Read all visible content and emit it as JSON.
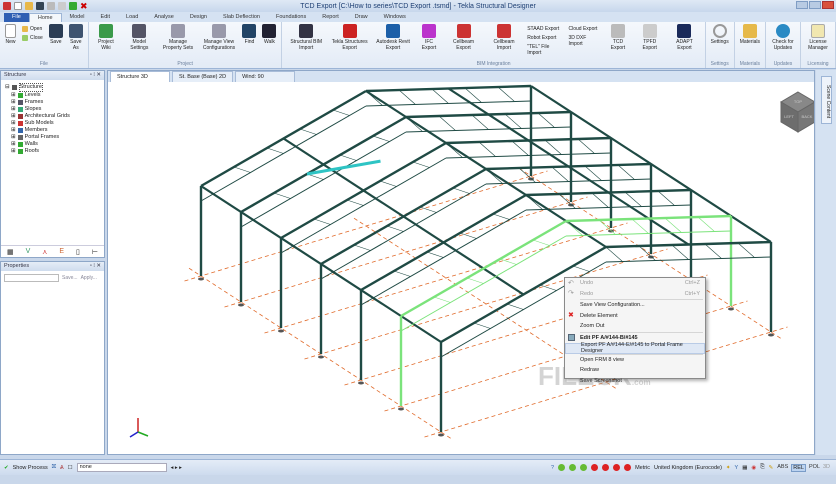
{
  "window": {
    "title": "TCD Export  [C:\\How to series\\TCD Export .tsmd] - Tekla Structural Designer"
  },
  "menu_tabs": [
    "File",
    "Home",
    "Model",
    "Edit",
    "Load",
    "Analyse",
    "Design",
    "Slab Deflection",
    "Foundations",
    "Report",
    "Draw",
    "Windows"
  ],
  "ribbon": {
    "file": {
      "label": "File",
      "new": "New",
      "open": "Open",
      "close": "Close",
      "save": "Save",
      "save_as": "Save As"
    },
    "project": {
      "label": "Project",
      "items": [
        "Project Wiki",
        "Model Settings",
        "Manage Property Sets",
        "Manage View Configurations",
        "Find",
        "Walk"
      ]
    },
    "bim": {
      "label": "BIM Integration",
      "items": [
        "Structural BIM Import",
        "Tekla Structures Export",
        "Autodesk Revit Export",
        "IFC Export",
        "Cellbeam Export",
        "Cellbeam Import"
      ],
      "small": [
        "STAAD Export",
        "Robot Export",
        "\"TEL\" File Import"
      ],
      "small2": [
        "Cloud Export",
        "3D DXF Import"
      ],
      "items2": [
        "TCD Export",
        "TPFD Export",
        "ADAPT Export"
      ]
    },
    "settings": {
      "label": "Settings",
      "item": "Settings"
    },
    "materials": {
      "label": "Materials",
      "item": "Materials"
    },
    "updates": {
      "label": "Updates",
      "item": "Check for Updates"
    },
    "licensing": {
      "label": "Licensing",
      "item": "License Manager"
    }
  },
  "structure_panel": {
    "title": "Structure",
    "root": "Structure",
    "items": [
      "Levels",
      "Frames",
      "Slopes",
      "Architectural Grids",
      "Sub Models",
      "Members",
      "Portal Frames",
      "Walls",
      "Roofs"
    ]
  },
  "properties_panel": {
    "title": "Properties",
    "save": "Save...",
    "apply": "Apply..."
  },
  "view_tabs": [
    "Structure 3D",
    "St. Base (Base) 2D",
    "Wind: 90"
  ],
  "side_tab": "Scene Content",
  "view_cube": {
    "faces": [
      "TOP",
      "LEFT",
      "BACK"
    ]
  },
  "context_menu": [
    {
      "label": "Undo",
      "shortcut": "Ctrl+Z",
      "disabled": true
    },
    {
      "label": "Redo",
      "shortcut": "Ctrl+Y",
      "disabled": true
    },
    {
      "label": "Save View Configuration..."
    },
    {
      "label": "Delete Element"
    },
    {
      "label": "Zoom Out"
    },
    {
      "label": "Edit PF A/#144-B/#145"
    },
    {
      "label": "Export PF A/#144-E/#145 to Portal Frame Designer"
    },
    {
      "label": "Open FRM 8 view"
    },
    {
      "label": "Redraw"
    },
    {
      "label": "Save Screenshot"
    }
  ],
  "watermark": "FILECR",
  "watermark_sub": ".com",
  "status": {
    "show_process": "Show Process",
    "filter": "none",
    "units": "Metric",
    "code": "United Kingdom (Eurocode)",
    "modes": [
      "ABS",
      "REL",
      "POL",
      "3D"
    ]
  },
  "colors": {
    "frame": "#1f4a44",
    "selected": "#2ec4c4",
    "highlight": "#7be37b",
    "grid": "#e06a2a",
    "accent": "#2f5fb3"
  }
}
